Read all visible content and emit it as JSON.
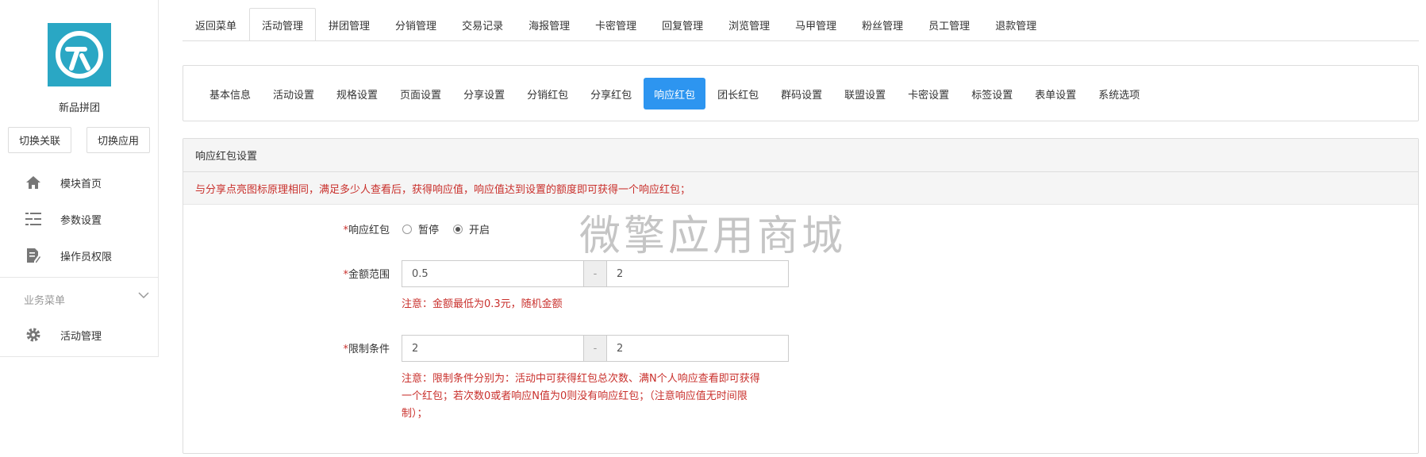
{
  "sidebar": {
    "app_name": "新品拼团",
    "switch_buttons": [
      "切换关联",
      "切换应用"
    ],
    "items": [
      {
        "label": "模块首页",
        "icon": "home-icon"
      },
      {
        "label": "参数设置",
        "icon": "list-settings-icon"
      },
      {
        "label": "操作员权限",
        "icon": "document-edit-icon"
      }
    ],
    "group_label": "业务菜单",
    "group_items": [
      {
        "label": "活动管理",
        "icon": "gear-icon"
      }
    ]
  },
  "top_tabs": [
    {
      "label": "返回菜单"
    },
    {
      "label": "活动管理",
      "active": true
    },
    {
      "label": "拼团管理"
    },
    {
      "label": "分销管理"
    },
    {
      "label": "交易记录"
    },
    {
      "label": "海报管理"
    },
    {
      "label": "卡密管理"
    },
    {
      "label": "回复管理"
    },
    {
      "label": "浏览管理"
    },
    {
      "label": "马甲管理"
    },
    {
      "label": "粉丝管理"
    },
    {
      "label": "员工管理"
    },
    {
      "label": "退款管理"
    }
  ],
  "sub_tabs": [
    {
      "label": "基本信息"
    },
    {
      "label": "活动设置"
    },
    {
      "label": "规格设置"
    },
    {
      "label": "页面设置"
    },
    {
      "label": "分享设置"
    },
    {
      "label": "分销红包"
    },
    {
      "label": "分享红包"
    },
    {
      "label": "响应红包",
      "active": true
    },
    {
      "label": "团长红包"
    },
    {
      "label": "群码设置"
    },
    {
      "label": "联盟设置"
    },
    {
      "label": "卡密设置"
    },
    {
      "label": "标签设置"
    },
    {
      "label": "表单设置"
    },
    {
      "label": "系统选项"
    }
  ],
  "settings": {
    "title": "响应红包设置",
    "notice": "与分享点亮图标原理相同，满足多少人查看后，获得响应值，响应值达到设置的额度即可获得一个响应红包；",
    "required_mark": "*",
    "fields": {
      "toggle": {
        "label": "响应红包",
        "options": [
          "暂停",
          "开启"
        ],
        "selected": "开启"
      },
      "amount": {
        "label": "金额范围",
        "min": "0.5",
        "max": "2",
        "separator": "-",
        "hint": "注意：金额最低为0.3元，随机金额"
      },
      "limit": {
        "label": "限制条件",
        "min": "2",
        "max": "2",
        "separator": "-",
        "hint_lines": [
          "注意：限制条件分别为：活动中可获得红包总次数、满N个人响应查看即可获得",
          "一个红包；若次数0或者响应N值为0则没有响应红包；（注意响应值无时间限",
          "制）；"
        ]
      }
    }
  },
  "watermark": "微擎应用商城",
  "colors": {
    "accent": "#2d95f0",
    "logo_bg": "#2aa7c4",
    "warning_text": "#c9302c"
  }
}
